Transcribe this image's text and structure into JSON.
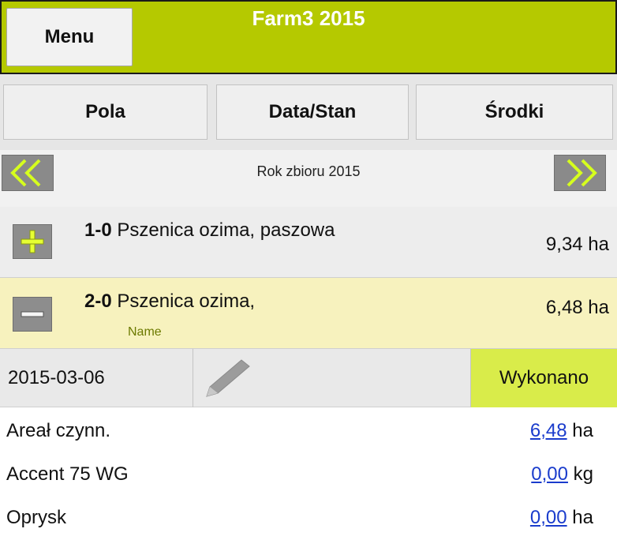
{
  "header": {
    "menu_label": "Menu",
    "title": "Farm3 2015",
    "background_color": "#b5c900"
  },
  "tabs": [
    {
      "label": "Pola"
    },
    {
      "label": "Data/Stan"
    },
    {
      "label": "Środki"
    }
  ],
  "year_nav": {
    "label": "Rok zbioru 2015",
    "prev_icon": "double-chevron-left-icon",
    "next_icon": "double-chevron-right-icon",
    "arrow_color": "#d6ff1e"
  },
  "fields": [
    {
      "id": "1-0",
      "name": "Pszenica ozima, paszowa",
      "sub": "",
      "area": "9,34 ha",
      "toggle_icon": "plus-icon",
      "expanded": false
    },
    {
      "id": "2-0",
      "name": "Pszenica ozima,",
      "sub": "Name",
      "area": "6,48 ha",
      "toggle_icon": "minus-icon",
      "expanded": true
    }
  ],
  "operation": {
    "date": "2015-03-06",
    "edit_icon": "pencil-icon",
    "status": "Wykonano",
    "status_color": "#d9ec4a"
  },
  "details": [
    {
      "label": "Areał czynn.",
      "value": "6,48",
      "unit": "ha"
    },
    {
      "label": "Accent 75 WG",
      "value": "0,00",
      "unit": "kg"
    },
    {
      "label": "Oprysk",
      "value": "0,00",
      "unit": "ha"
    }
  ]
}
